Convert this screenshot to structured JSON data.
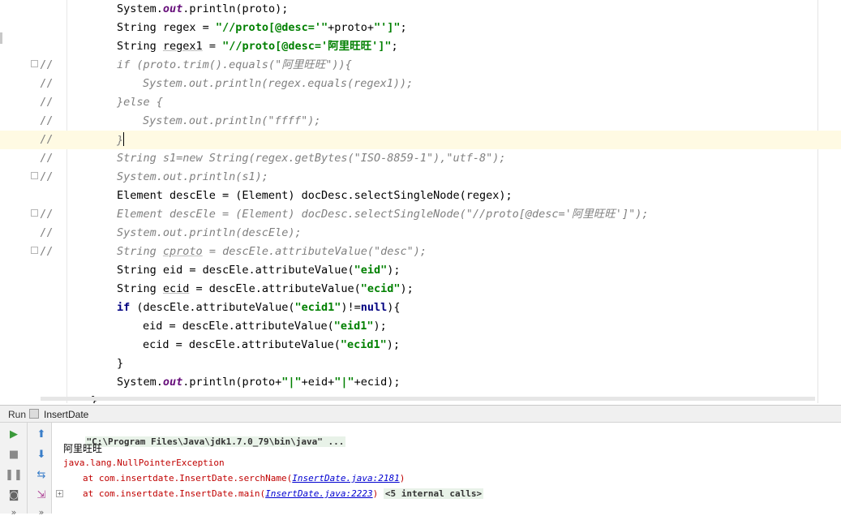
{
  "editor": {
    "lines": [
      {
        "marker": "",
        "fold": false,
        "indent": 1,
        "tokens": [
          [
            "plain",
            "System."
          ],
          [
            "fld",
            "out"
          ],
          [
            "plain",
            ".println(proto);"
          ]
        ]
      },
      {
        "marker": "",
        "fold": false,
        "indent": 1,
        "tokens": [
          [
            "plain",
            "String regex = "
          ],
          [
            "st",
            "\"//proto[@desc='\""
          ],
          [
            "plain",
            "+proto+"
          ],
          [
            "st",
            "\"']\""
          ],
          [
            "plain",
            ";"
          ]
        ]
      },
      {
        "marker": "",
        "fold": false,
        "indent": 1,
        "tokens": [
          [
            "plain",
            "String "
          ],
          [
            "ul",
            "regex1"
          ],
          [
            "plain",
            " = "
          ],
          [
            "st",
            "\"//proto[@desc='阿里旺旺']\""
          ],
          [
            "plain",
            ";"
          ]
        ]
      },
      {
        "marker": "//",
        "fold": true,
        "indent": 1,
        "tokens": [
          [
            "cmt",
            "if (proto.trim().equals(\"阿里旺旺\")){"
          ]
        ]
      },
      {
        "marker": "//",
        "fold": false,
        "indent": 2,
        "tokens": [
          [
            "cmt",
            "System.out.println(regex.equals(regex1));"
          ]
        ]
      },
      {
        "marker": "//",
        "fold": false,
        "indent": 1,
        "tokens": [
          [
            "cmt",
            "}else {"
          ]
        ]
      },
      {
        "marker": "//",
        "fold": false,
        "indent": 2,
        "tokens": [
          [
            "cmt",
            "System.out.println(\"ffff\");"
          ]
        ]
      },
      {
        "marker": "//",
        "fold": false,
        "indent": 1,
        "current": true,
        "tokens": [
          [
            "cmt",
            "}"
          ],
          [
            "caret",
            ""
          ]
        ]
      },
      {
        "marker": "//",
        "fold": false,
        "indent": 1,
        "tokens": [
          [
            "cmt",
            "String s1=new String(regex.getBytes(\"ISO-8859-1\"),\"utf-8\");"
          ]
        ]
      },
      {
        "marker": "//",
        "fold": true,
        "indent": 1,
        "tokens": [
          [
            "cmt",
            "System.out.println(s1);"
          ]
        ]
      },
      {
        "marker": "",
        "fold": false,
        "indent": 1,
        "tokens": [
          [
            "plain",
            "Element descEle = (Element) docDesc.selectSingleNode(regex);"
          ]
        ]
      },
      {
        "marker": "//",
        "fold": true,
        "indent": 1,
        "tokens": [
          [
            "cmt",
            "Element descEle = (Element) docDesc.selectSingleNode(\"//proto[@desc='阿里旺旺']\");"
          ]
        ]
      },
      {
        "marker": "//",
        "fold": false,
        "indent": 1,
        "tokens": [
          [
            "cmt",
            "System.out.println(descEle);"
          ]
        ]
      },
      {
        "marker": "//",
        "fold": true,
        "indent": 1,
        "tokens": [
          [
            "cmt",
            "String "
          ],
          [
            "cmtul",
            "cproto"
          ],
          [
            "cmt",
            " = descEle.attributeValue(\"desc\");"
          ]
        ]
      },
      {
        "marker": "",
        "fold": false,
        "indent": 1,
        "tokens": [
          [
            "plain",
            "String eid = descEle.attributeValue("
          ],
          [
            "st",
            "\"eid\""
          ],
          [
            "plain",
            ");"
          ]
        ]
      },
      {
        "marker": "",
        "fold": false,
        "indent": 1,
        "tokens": [
          [
            "plain",
            "String "
          ],
          [
            "ul",
            "ecid"
          ],
          [
            "plain",
            " = descEle.attributeValue("
          ],
          [
            "st",
            "\"ecid\""
          ],
          [
            "plain",
            ");"
          ]
        ]
      },
      {
        "marker": "",
        "fold": false,
        "indent": 1,
        "tokens": [
          [
            "kw",
            "if"
          ],
          [
            "plain",
            " (descEle.attributeValue("
          ],
          [
            "st",
            "\"ecid1\""
          ],
          [
            "plain",
            ")!="
          ],
          [
            "kw",
            "null"
          ],
          [
            "plain",
            "){"
          ]
        ]
      },
      {
        "marker": "",
        "fold": false,
        "indent": 2,
        "tokens": [
          [
            "plain",
            "eid = descEle.attributeValue("
          ],
          [
            "st",
            "\"eid1\""
          ],
          [
            "plain",
            ");"
          ]
        ]
      },
      {
        "marker": "",
        "fold": false,
        "indent": 2,
        "tokens": [
          [
            "plain",
            "ecid = descEle.attributeValue("
          ],
          [
            "st",
            "\"ecid1\""
          ],
          [
            "plain",
            ");"
          ]
        ]
      },
      {
        "marker": "",
        "fold": false,
        "indent": 1,
        "tokens": [
          [
            "plain",
            "}"
          ]
        ]
      },
      {
        "marker": "",
        "fold": false,
        "indent": 1,
        "tokens": [
          [
            "plain",
            "System."
          ],
          [
            "fld",
            "out"
          ],
          [
            "plain",
            ".println(proto+"
          ],
          [
            "st",
            "\"|\""
          ],
          [
            "plain",
            "+eid+"
          ],
          [
            "st",
            "\"|\""
          ],
          [
            "plain",
            "+ecid);"
          ]
        ]
      }
    ],
    "closing_brace": "}"
  },
  "run_panel": {
    "run_label": "Run",
    "tab_label": "InsertDate",
    "tab_icon": "class-file-icon",
    "toolbar_left": [
      {
        "name": "rerun-icon",
        "glyph": "▶",
        "color": "#3a9a3a"
      },
      {
        "name": "stop-icon",
        "glyph": "■",
        "color": "#8a8a8a"
      },
      {
        "name": "pause-icon",
        "glyph": "❚❚",
        "color": "#8a8a8a"
      },
      {
        "name": "camera-icon",
        "glyph": "◙",
        "color": "#666666"
      }
    ],
    "toolbar_right": [
      {
        "name": "scroll-up-icon",
        "glyph": "⬆",
        "color": "#3a7ec9"
      },
      {
        "name": "scroll-down-icon",
        "glyph": "⬇",
        "color": "#3a7ec9"
      },
      {
        "name": "soft-wrap-icon",
        "glyph": "⇆",
        "color": "#3a7ec9"
      },
      {
        "name": "scroll-to-end-icon",
        "glyph": "⇲",
        "color": "#b04a9a"
      }
    ],
    "more_glyph": "»",
    "console": {
      "command": "\"C:\\Program Files\\Java\\jdk1.7.0_79\\bin\\java\" ...",
      "output": "阿里旺旺",
      "exception": "java.lang.NullPointerException",
      "trace1_prefix": "at com.insertdate.InsertDate.serchName(",
      "trace1_link": "InsertDate.java:2181",
      "trace1_suffix": ")",
      "trace2_prefix": "at com.insertdate.InsertDate.main(",
      "trace2_link": "InsertDate.java:2223",
      "trace2_suffix": ")",
      "internal_calls": "<5 internal calls>",
      "expand_glyph": "+"
    }
  }
}
